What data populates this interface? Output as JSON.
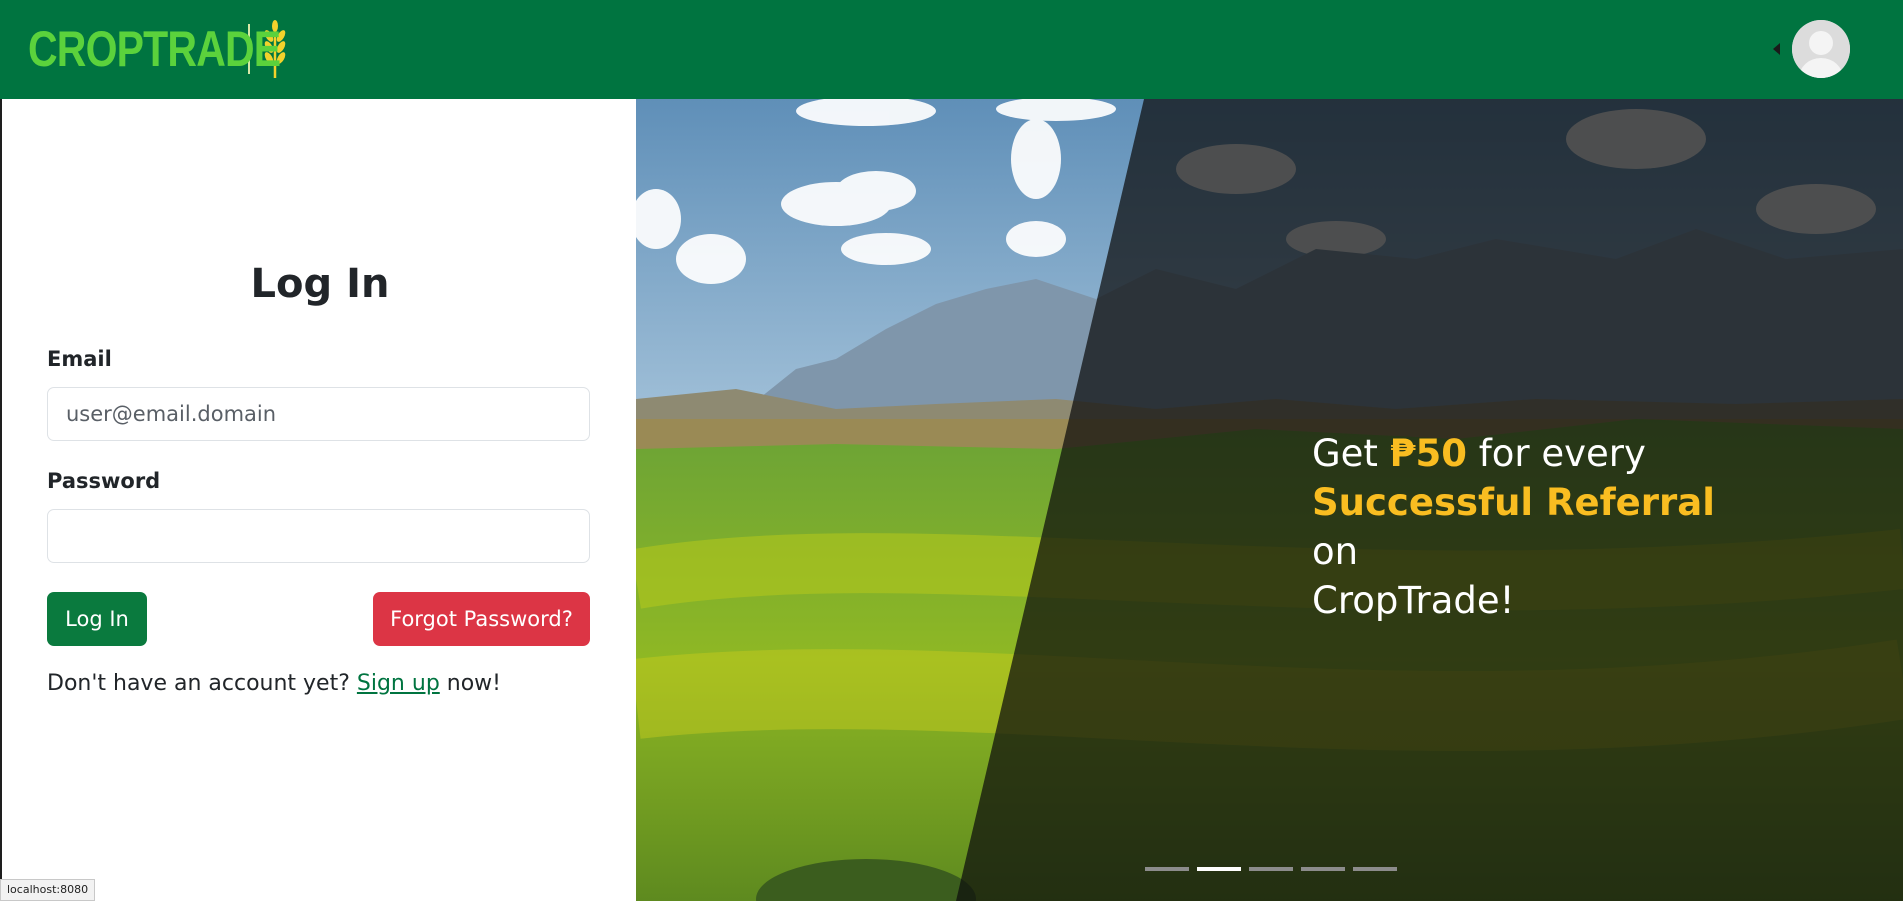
{
  "header": {
    "brand": "CROPTRADE",
    "logo_icon": "wheat-icon",
    "profile_icon": "user-avatar-icon"
  },
  "login": {
    "title": "Log In",
    "email_label": "Email",
    "email_placeholder": "user@email.domain",
    "email_value": "",
    "password_label": "Password",
    "password_value": "",
    "login_button": "Log In",
    "forgot_button": "Forgot Password?",
    "signup_prefix": "Don't have an account yet? ",
    "signup_link": "Sign up",
    "signup_suffix": " now!"
  },
  "hero": {
    "promo_get": "Get ",
    "promo_amount": "₱50",
    "promo_for_every": " for every ",
    "promo_highlight": "Successful Referral",
    "promo_on": " on",
    "promo_end": "CropTrade!",
    "carousel_total": 5,
    "carousel_active": 2
  },
  "status_bar": {
    "url": "localhost:8080"
  },
  "colors": {
    "navbar": "#007440",
    "brand_text": "#5bd23c",
    "login_button": "#0a7a3e",
    "forgot_button": "#dc3545",
    "highlight": "#f9bd21"
  }
}
